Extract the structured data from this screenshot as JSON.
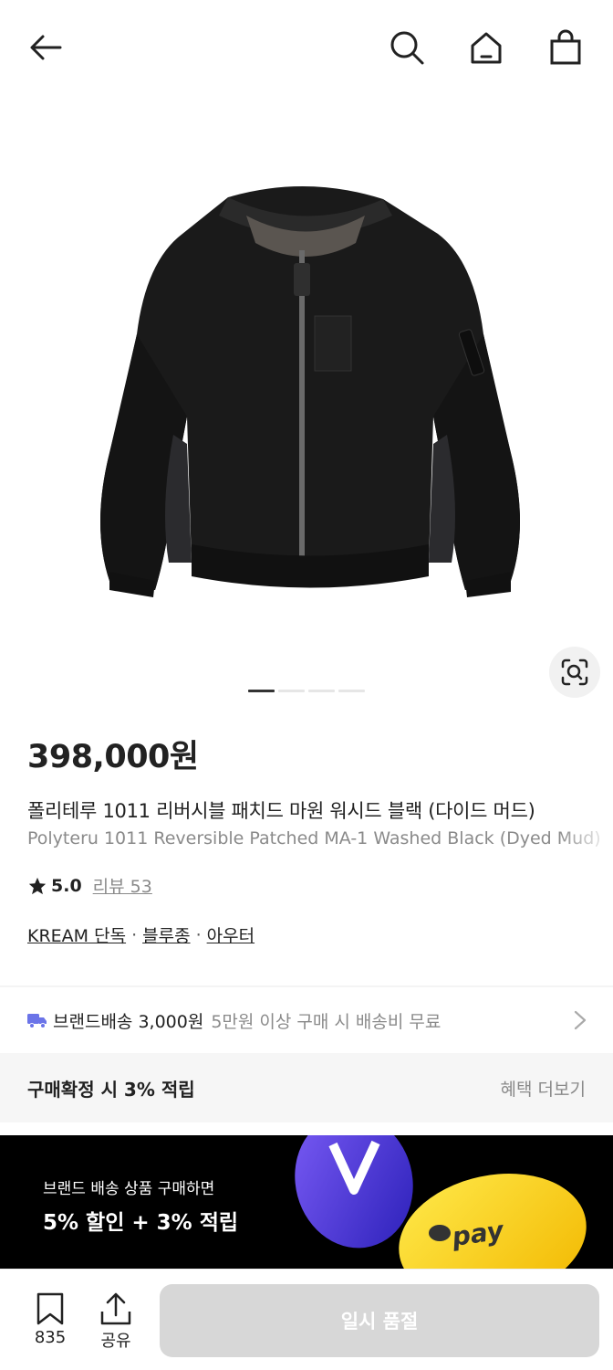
{
  "header": {
    "back_icon": "arrow-left-icon",
    "search_icon": "search-icon",
    "home_icon": "home-icon",
    "bag_icon": "shopping-bag-icon"
  },
  "gallery": {
    "image_desc_icon": "jacket-photo",
    "lens_icon": "lens-search-icon",
    "page_count": 4,
    "active_index": 0
  },
  "product": {
    "price": "398,000원",
    "title_ko": "폴리테루 1011 리버시블 패치드 마원 워시드 블랙 (다이드 머드)",
    "title_en": "Polyteru 1011 Reversible Patched MA-1 Washed Black (Dyed Mud)",
    "rating_score": "5.0",
    "review_label": "리뷰 53",
    "categories": [
      "KREAM 단독",
      "블루종",
      "아우터"
    ],
    "separator": "·"
  },
  "shipping": {
    "label": "브랜드배송 3,000원",
    "note": "5만원 이상 구매 시 배송비 무료",
    "color": "#6b74e8"
  },
  "benefit": {
    "title": "구매확정 시 3% 적립",
    "more": "혜택 더보기"
  },
  "banner": {
    "sub": "브랜드 배송 상품 구매하면",
    "main": "5% 할인 + 3% 적립",
    "pay_text": "pay"
  },
  "bottom": {
    "bookmark_count": "835",
    "share_label": "공유",
    "cta_label": "일시 품절"
  }
}
